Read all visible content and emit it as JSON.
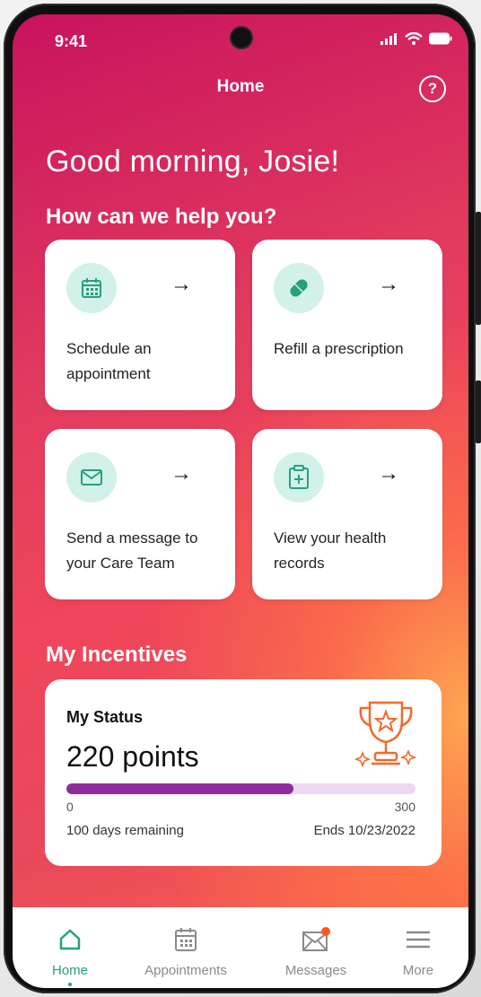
{
  "status_bar": {
    "time": "9:41"
  },
  "header": {
    "title": "Home",
    "help_symbol": "?"
  },
  "greeting": "Good morning, Josie!",
  "help_heading": "How can we help you?",
  "actions": [
    {
      "label": "Schedule an appointment",
      "icon": "calendar-icon",
      "arrow": "→"
    },
    {
      "label": "Refill a prescription",
      "icon": "pill-icon",
      "arrow": "→"
    },
    {
      "label": "Send a message to your Care Team",
      "icon": "envelope-icon",
      "arrow": "→"
    },
    {
      "label": "View your health records",
      "icon": "medical-clipboard-icon",
      "arrow": "→"
    }
  ],
  "incentives": {
    "heading": "My Incentives",
    "status_title": "My Status",
    "points_label": "220 points",
    "progress_min": "0",
    "progress_max": "300",
    "progress_fraction": 0.65,
    "days_remaining": "100 days remaining",
    "ends": "Ends 10/23/2022"
  },
  "nav": [
    {
      "label": "Home",
      "icon": "home-icon",
      "active": true
    },
    {
      "label": "Appointments",
      "icon": "calendar-icon",
      "active": false
    },
    {
      "label": "Messages",
      "icon": "mail-icon",
      "active": false,
      "badge": true
    },
    {
      "label": "More",
      "icon": "menu-icon",
      "active": false
    }
  ],
  "colors": {
    "accent_green": "#26a07e",
    "icon_bg": "#d2f1e8",
    "progress_fill": "#8f2c9c",
    "progress_track": "#ecd8ef",
    "badge": "#ff5a1f",
    "trophy": "#f06a2a"
  }
}
